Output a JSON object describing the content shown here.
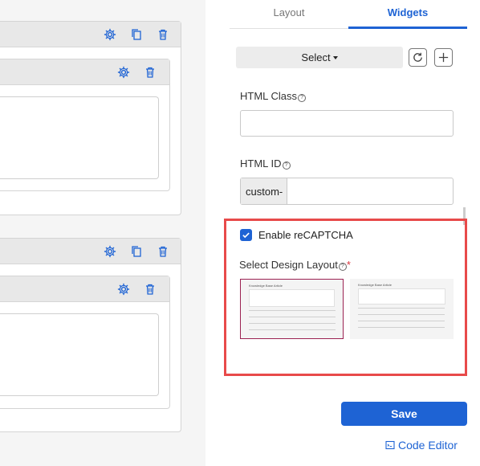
{
  "tabs": {
    "layout": "Layout",
    "widgets": "Widgets"
  },
  "toolbar": {
    "select_label": "Select"
  },
  "fields": {
    "html_class_label": "HTML Class",
    "html_class_value": "",
    "html_id_label": "HTML ID",
    "html_id_prefix": "custom-",
    "html_id_value": ""
  },
  "recaptcha": {
    "label": "Enable reCAPTCHA",
    "checked": true
  },
  "design_layout": {
    "label": "Select Design Layout",
    "required_mark": "*",
    "options": [
      {
        "title": "Knowledge Base Article",
        "selected": true
      },
      {
        "title": "Knowledge Base Article",
        "selected": false
      }
    ]
  },
  "actions": {
    "save_label": "Save",
    "code_editor_label": "Code Editor"
  },
  "colors": {
    "accent": "#1e63d4",
    "highlight": "#e84a4a",
    "selected_border": "#9b2252"
  }
}
